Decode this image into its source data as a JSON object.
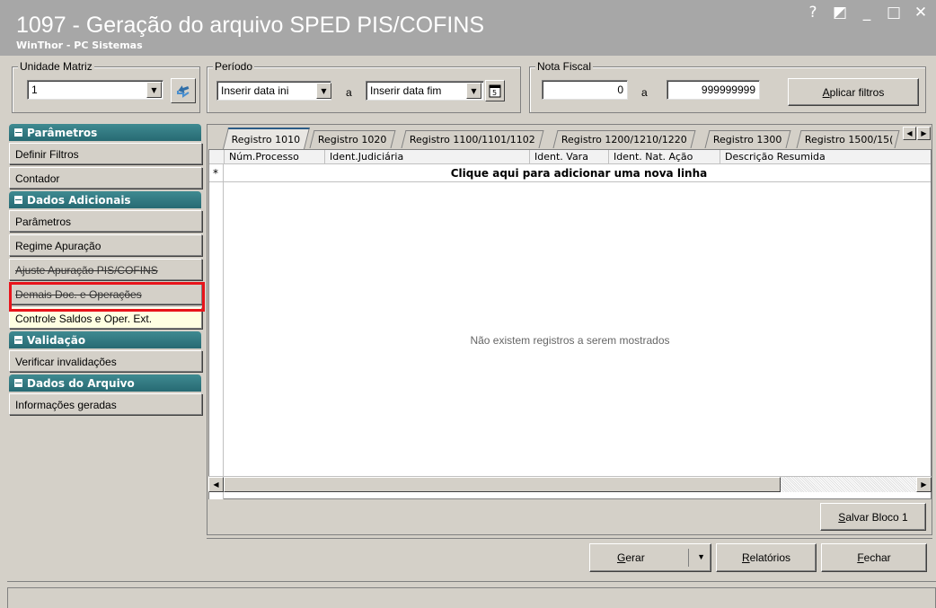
{
  "window": {
    "title": "1097 - Geração do arquivo SPED PIS/COFINS",
    "subtitle": "WinThor - PC Sistemas",
    "controls": [
      "?",
      "◩",
      "_",
      "□",
      "✕"
    ]
  },
  "filters": {
    "unidade_matriz": {
      "label": "Unidade Matriz",
      "value": "1"
    },
    "periodo": {
      "label": "Período",
      "data_ini": "Inserir data ini",
      "sep": "a",
      "data_fim": "Inserir data fim"
    },
    "nota_fiscal": {
      "label": "Nota Fiscal",
      "from": "0",
      "sep": "a",
      "to": "999999999"
    },
    "aplicar_first": "A",
    "aplicar_rest": "plicar filtros"
  },
  "sidebar": {
    "sections": [
      {
        "title": "Parâmetros",
        "items": [
          "Definir Filtros",
          "Contador"
        ]
      },
      {
        "title": "Dados Adicionais",
        "items": [
          "Parâmetros",
          "Regime Apuração",
          "Ajuste Apuração PIS/COFINS",
          "Demais Doc. e Operações",
          "Controle Saldos e Oper. Ext."
        ]
      },
      {
        "title": "Validação",
        "items": [
          "Verificar invalidações"
        ]
      },
      {
        "title": "Dados do Arquivo",
        "items": [
          "Informações geradas"
        ]
      }
    ]
  },
  "tabs": [
    "Registro 1010",
    "Registro 1020",
    "Registro 1100/1101/1102",
    "Registro 1200/1210/1220",
    "Registro 1300",
    "Registro 1500/15("
  ],
  "grid": {
    "columns": [
      "Núm.Processo",
      "Ident.Judiciária",
      "Ident. Vara",
      "Ident. Nat. Ação",
      "Descrição Resumida"
    ],
    "new_row_marker": "*",
    "new_row_text": "Clique aqui para adicionar uma nova linha",
    "empty_text": "Não existem registros a serem mostrados"
  },
  "buttons": {
    "salvar_first": "S",
    "salvar_rest": "alvar Bloco 1",
    "gerar_first": "G",
    "gerar_rest": "erar",
    "relatorios_first": "R",
    "relatorios_rest": "elatórios",
    "fechar_first": "F",
    "fechar_rest": "echar"
  },
  "icons": {
    "refresh": "refresh-icon",
    "calendar": "calendar-icon",
    "dropdown": "chevron-down-icon"
  },
  "colors": {
    "section_header": "#276a73",
    "highlight": "#e8141b",
    "titlebar": "#a7a7a7",
    "active_tab_top": "#2b5b86"
  }
}
